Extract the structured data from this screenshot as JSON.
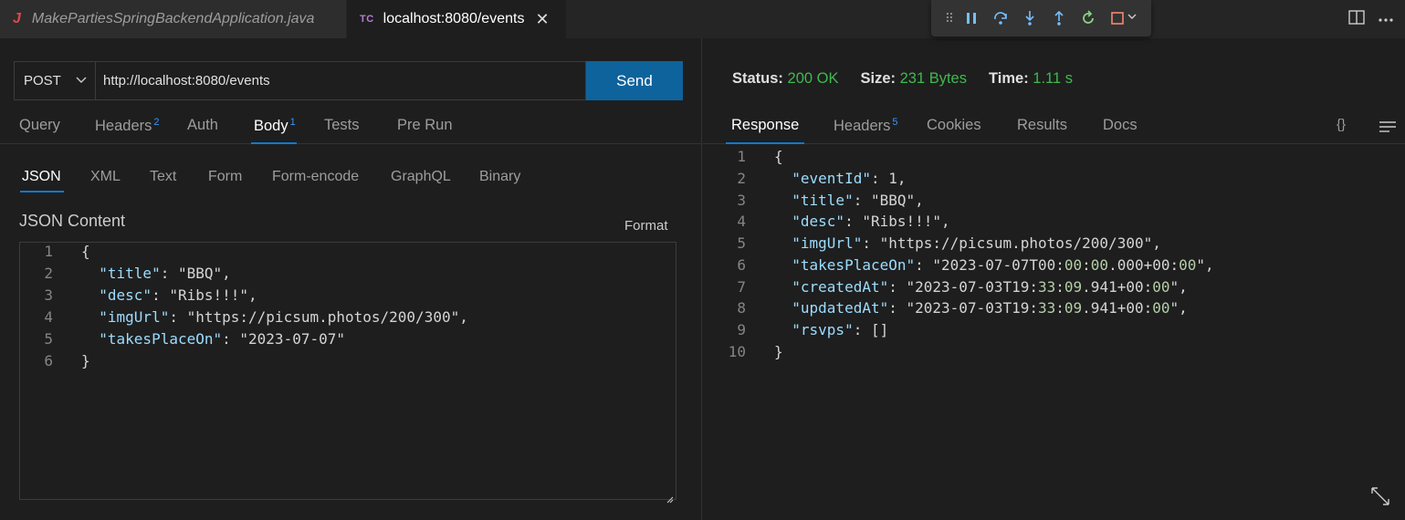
{
  "tabs": [
    {
      "icon": "J",
      "label": "MakePartiesSpringBackendApplication.java"
    },
    {
      "icon": "TC",
      "label": "localhost:8080/events",
      "close": "✕"
    }
  ],
  "request": {
    "method": "POST",
    "url": "http://localhost:8080/events",
    "send_label": "Send",
    "tabs": [
      {
        "label": "Query",
        "badge": ""
      },
      {
        "label": "Headers",
        "badge": "2"
      },
      {
        "label": "Auth",
        "badge": ""
      },
      {
        "label": "Body",
        "badge": "1"
      },
      {
        "label": "Tests",
        "badge": ""
      },
      {
        "label": "Pre Run",
        "badge": ""
      }
    ],
    "active_tab": "Body",
    "body_types": [
      "JSON",
      "XML",
      "Text",
      "Form",
      "Form-encode",
      "GraphQL",
      "Binary"
    ],
    "active_body_type": "JSON",
    "content_title": "JSON Content",
    "format_label": "Format",
    "line_numbers": [
      "1",
      "2",
      "3",
      "4",
      "5",
      "6"
    ],
    "body_lines": [
      "{",
      "  \"title\": \"BBQ\",",
      "  \"desc\": \"Ribs!!!\",",
      "  \"imgUrl\": \"https://picsum.photos/200/300\",",
      "  \"takesPlaceOn\": \"2023-07-07\"",
      "}"
    ]
  },
  "response": {
    "status_label": "Status:",
    "status_value": "200 OK",
    "size_label": "Size:",
    "size_value": "231 Bytes",
    "time_label": "Time:",
    "time_value": "1.11 s",
    "tabs": [
      {
        "label": "Response",
        "badge": ""
      },
      {
        "label": "Headers",
        "badge": "5"
      },
      {
        "label": "Cookies",
        "badge": ""
      },
      {
        "label": "Results",
        "badge": ""
      },
      {
        "label": "Docs",
        "badge": ""
      }
    ],
    "active_tab": "Response",
    "braces_label": "{}",
    "line_numbers": [
      "1",
      "2",
      "3",
      "4",
      "5",
      "6",
      "7",
      "8",
      "9",
      "10"
    ],
    "body_lines": [
      "{",
      "  \"eventId\": 1,",
      "  \"title\": \"BBQ\",",
      "  \"desc\": \"Ribs!!!\",",
      "  \"imgUrl\": \"https://picsum.photos/200/300\",",
      "  \"takesPlaceOn\": \"2023-07-07T00:00:00.000+00:00\",",
      "  \"createdAt\": \"2023-07-03T19:33:09.941+00:00\",",
      "  \"updatedAt\": \"2023-07-03T19:33:09.941+00:00\",",
      "  \"rsvps\": []",
      "}"
    ]
  },
  "colors": {
    "accent": "#0e639c",
    "status_green": "#3fb950",
    "json_key": "#9cdcfe",
    "json_string": "#ce9178",
    "json_number": "#b5cea8"
  },
  "icons": [
    "grip-icon",
    "pause-icon",
    "step-over-icon",
    "step-into-icon",
    "step-out-icon",
    "restart-icon",
    "stop-icon",
    "chevron-down-icon",
    "split-editor-icon",
    "more-icon",
    "close-icon",
    "wrap-icon",
    "expand-icon"
  ]
}
